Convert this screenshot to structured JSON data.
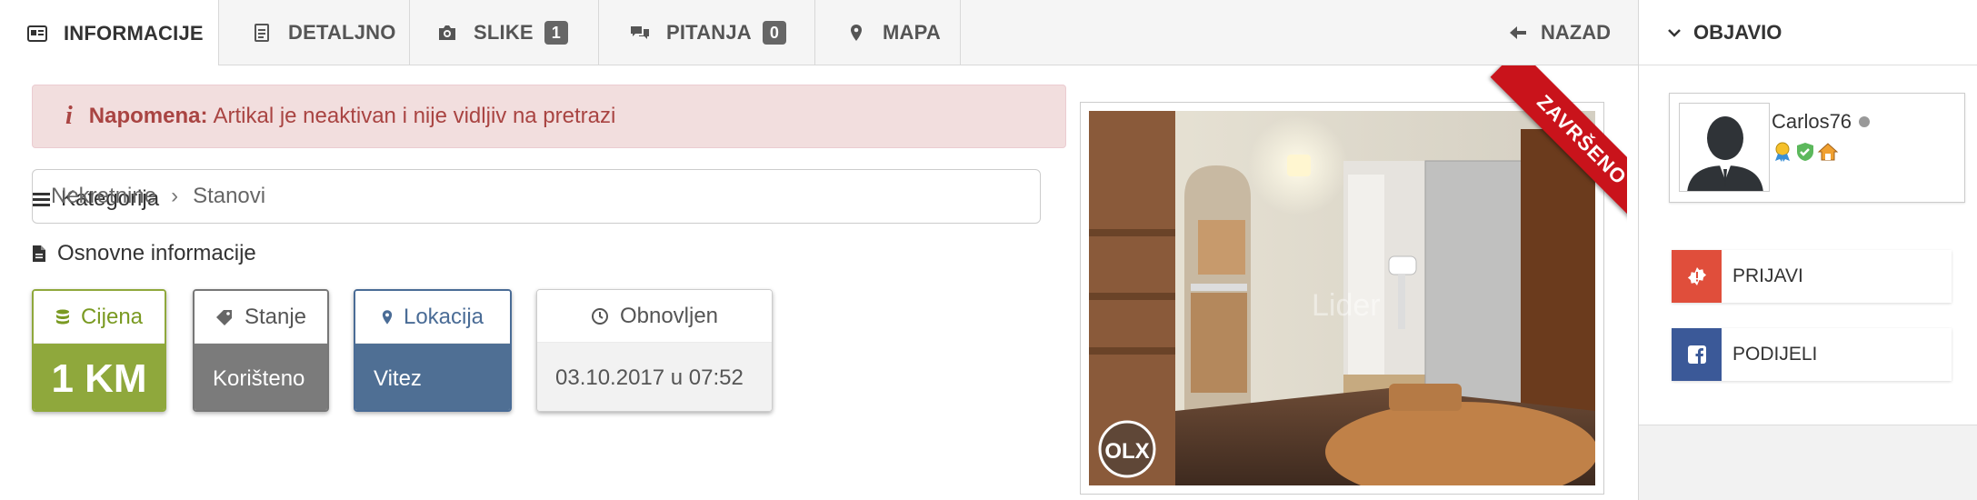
{
  "tabs": [
    {
      "label": "INFORMACIJE",
      "icon": "id-card-icon",
      "active": true
    },
    {
      "label": "DETALJNO",
      "icon": "document-icon",
      "active": false
    },
    {
      "label": "SLIKE",
      "icon": "camera-icon",
      "badge": "1",
      "active": false
    },
    {
      "label": "PITANJA",
      "icon": "comments-icon",
      "badge": "0",
      "active": false
    },
    {
      "label": "MAPA",
      "icon": "map-marker-icon",
      "active": false
    }
  ],
  "back": {
    "label": "NAZAD",
    "icon": "arrow-left-icon"
  },
  "notice": {
    "icon": "info-icon",
    "label": "Napomena:",
    "text": "Artikal je neaktivan i nije vidljiv na pretrazi"
  },
  "category": {
    "title": "Kategorija",
    "path": [
      "Nekretnine",
      "Stanovi"
    ],
    "separator": "›"
  },
  "basic_info": {
    "title": "Osnovne informacije",
    "cards": {
      "price": {
        "label": "Cijena",
        "value": "1 KM",
        "color": "#8fa83c"
      },
      "condition": {
        "label": "Stanje",
        "value": "Korišteno",
        "color": "#7b7b7b"
      },
      "location": {
        "label": "Lokacija",
        "value": "Vitez",
        "color": "#4f6f94"
      },
      "updated": {
        "label": "Obnovljen",
        "value": "03.10.2017 u 07:52"
      }
    }
  },
  "listing_image": {
    "ribbon": "ZAVRŠENO",
    "watermark": "OLX"
  },
  "sidebar": {
    "title": "OBJAVIO",
    "user": {
      "name": "Carlos76",
      "status": "offline"
    },
    "buttons": {
      "report": {
        "label": "PRIJAVI",
        "color": "#e04e3b"
      },
      "share": {
        "label": "PODIJELI",
        "color": "#3b5998"
      }
    }
  }
}
